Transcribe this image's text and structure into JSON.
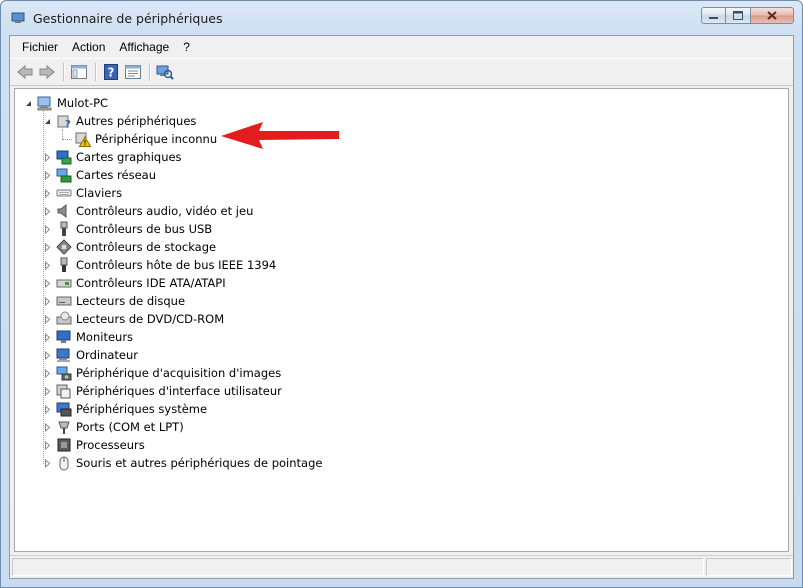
{
  "window": {
    "title": "Gestionnaire de périphériques"
  },
  "menu": [
    "Fichier",
    "Action",
    "Affichage",
    "?"
  ],
  "toolbar": {
    "buttons": [
      "back-icon",
      "forward-icon",
      "console-tree-icon",
      "help-icon",
      "properties-icon",
      "scan-hardware-icon"
    ]
  },
  "tree": {
    "root": {
      "label": "Mulot-PC",
      "icon": "computer-icon"
    },
    "other": {
      "label": "Autres périphériques",
      "icon": "unknown-device-icon"
    },
    "unknown": {
      "label": "Périphérique inconnu",
      "icon": "warning-device-icon"
    },
    "categories": [
      {
        "label": "Cartes graphiques",
        "icon": "display-adapter-icon"
      },
      {
        "label": "Cartes réseau",
        "icon": "network-adapter-icon"
      },
      {
        "label": "Claviers",
        "icon": "keyboard-icon"
      },
      {
        "label": "Contrôleurs audio, vidéo et jeu",
        "icon": "speaker-icon"
      },
      {
        "label": "Contrôleurs de bus USB",
        "icon": "usb-icon"
      },
      {
        "label": "Contrôleurs de stockage",
        "icon": "storage-icon"
      },
      {
        "label": "Contrôleurs hôte de bus IEEE 1394",
        "icon": "firewire-icon"
      },
      {
        "label": "Contrôleurs IDE ATA/ATAPI",
        "icon": "ide-icon"
      },
      {
        "label": "Lecteurs de disque",
        "icon": "disk-drive-icon"
      },
      {
        "label": "Lecteurs de DVD/CD-ROM",
        "icon": "dvd-icon"
      },
      {
        "label": "Moniteurs",
        "icon": "monitor-icon"
      },
      {
        "label": "Ordinateur",
        "icon": "computer-icon"
      },
      {
        "label": "Périphérique d'acquisition d'images",
        "icon": "camera-icon"
      },
      {
        "label": "Périphériques d'interface utilisateur",
        "icon": "hid-icon"
      },
      {
        "label": "Périphériques système",
        "icon": "system-device-icon"
      },
      {
        "label": "Ports (COM et LPT)",
        "icon": "port-icon"
      },
      {
        "label": "Processeurs",
        "icon": "processor-icon"
      },
      {
        "label": "Souris et autres périphériques de pointage",
        "icon": "mouse-icon"
      }
    ]
  },
  "colors": {
    "arrow": "#e21d1d",
    "warning": "#f2c200"
  }
}
